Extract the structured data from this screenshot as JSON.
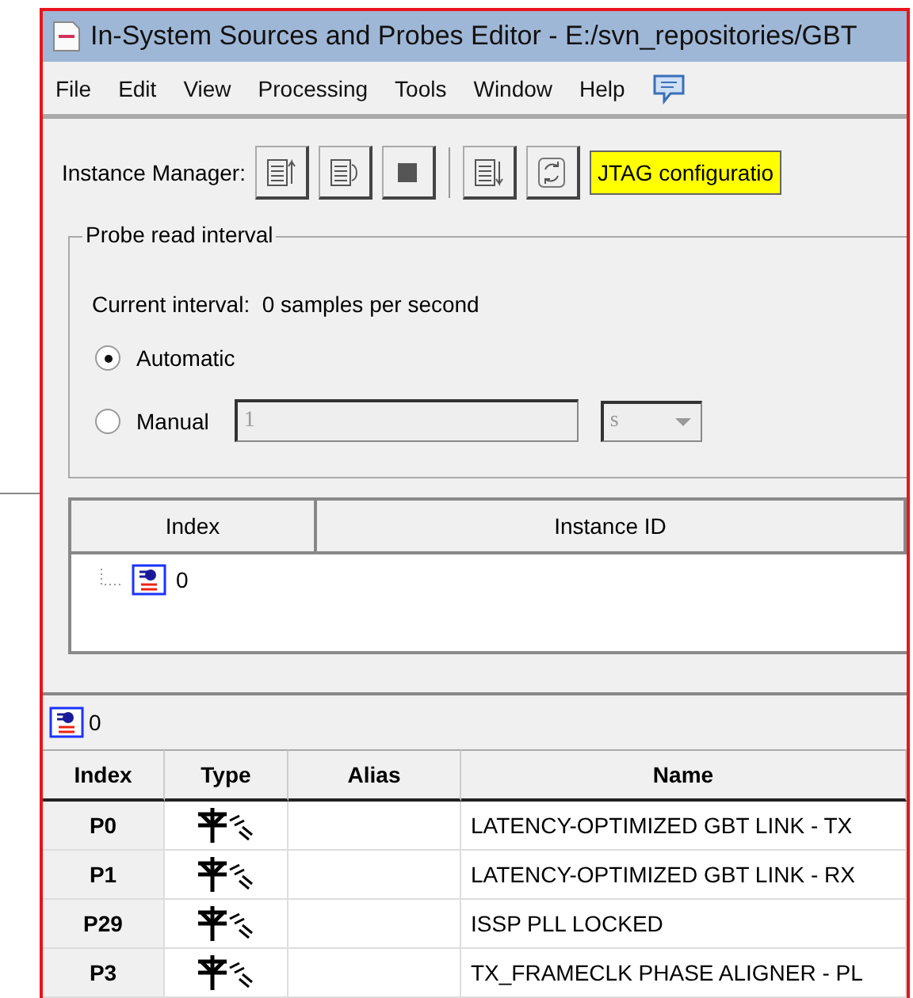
{
  "window": {
    "title": "In-System Sources and Probes Editor - E:/svn_repositories/GBT"
  },
  "menu": [
    "File",
    "Edit",
    "View",
    "Processing",
    "Tools",
    "Window",
    "Help"
  ],
  "toolbar": {
    "label": "Instance Manager:",
    "device_field": "JTAG configuratio"
  },
  "probe_read_interval": {
    "title": "Probe read interval",
    "current": "Current interval:  0 samples per second",
    "modes": [
      {
        "label": "Automatic",
        "selected": true
      },
      {
        "label": "Manual",
        "selected": false
      }
    ],
    "interval_field": {
      "value": "1",
      "disabled": true
    },
    "unit_select": {
      "value": "s",
      "disabled": true
    }
  },
  "instances": {
    "columns": [
      "Index",
      "Instance ID"
    ],
    "rows": [
      {
        "index": "0"
      }
    ]
  },
  "probes": {
    "instance": "0",
    "columns": [
      "Index",
      "Type",
      "Alias",
      "Name"
    ],
    "rows": [
      {
        "index": "P0",
        "name": "LATENCY-OPTIMIZED GBT LINK - TX"
      },
      {
        "index": "P1",
        "name": "LATENCY-OPTIMIZED GBT LINK - RX"
      },
      {
        "index": "P29",
        "name": "ISSP PLL LOCKED"
      },
      {
        "index": "P3",
        "name": "TX_FRAMECLK PHASE ALIGNER - PL"
      }
    ]
  }
}
